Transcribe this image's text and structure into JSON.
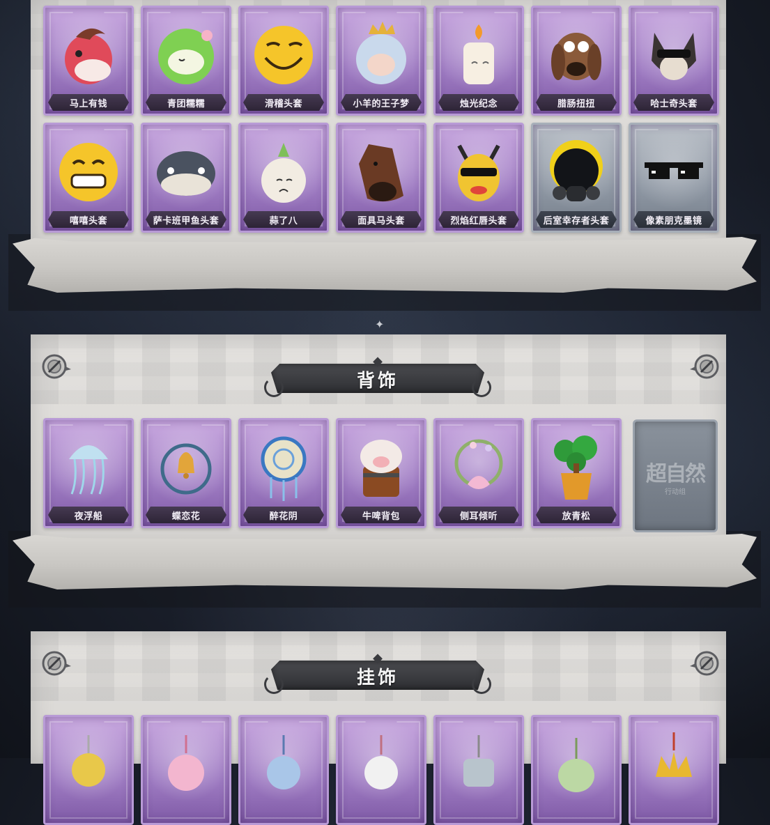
{
  "sections": [
    {
      "id": "head",
      "title": "",
      "items": [
        {
          "label": "马上有钱",
          "icon": "red-horse-mask-icon",
          "tint": "purple"
        },
        {
          "label": "青团糯糯",
          "icon": "green-rice-ball-icon",
          "tint": "purple"
        },
        {
          "label": "滑稽头套",
          "icon": "funny-face-icon",
          "tint": "purple"
        },
        {
          "label": "小羊的王子梦",
          "icon": "crowned-sheep-icon",
          "tint": "purple"
        },
        {
          "label": "烛光纪念",
          "icon": "candle-head-icon",
          "tint": "purple"
        },
        {
          "label": "腊肠扭扭",
          "icon": "dachshund-head-icon",
          "tint": "purple"
        },
        {
          "label": "哈士奇头套",
          "icon": "husky-sunglasses-icon",
          "tint": "purple"
        }
      ],
      "items_row2": [
        {
          "label": "嘻嘻头套",
          "icon": "grinning-face-icon",
          "tint": "purple"
        },
        {
          "label": "萨卡班甲鱼头套",
          "icon": "fish-head-icon",
          "tint": "purple"
        },
        {
          "label": "蒜了八",
          "icon": "garlic-head-icon",
          "tint": "purple"
        },
        {
          "label": "面具马头套",
          "icon": "horse-mask-icon",
          "tint": "purple"
        },
        {
          "label": "烈焰红唇头套",
          "icon": "yellow-mask-sunglasses-icon",
          "tint": "purple"
        },
        {
          "label": "后室幸存者头套",
          "icon": "gas-mask-helmet-icon",
          "tint": "gray"
        },
        {
          "label": "像素朋克墨镜",
          "icon": "pixel-sunglasses-icon",
          "tint": "gray"
        }
      ]
    },
    {
      "id": "back",
      "title": "背饰",
      "items": [
        {
          "label": "夜浮船",
          "icon": "jellyfish-ornament-icon",
          "tint": "purple"
        },
        {
          "label": "蝶恋花",
          "icon": "bell-wreath-icon",
          "tint": "purple"
        },
        {
          "label": "醉花阴",
          "icon": "dreamcatcher-icon",
          "tint": "purple"
        },
        {
          "label": "牛啤背包",
          "icon": "cow-beer-mug-icon",
          "tint": "purple"
        },
        {
          "label": "侧耳倾听",
          "icon": "lotus-wreath-icon",
          "tint": "purple"
        },
        {
          "label": "放青松",
          "icon": "potted-pine-icon",
          "tint": "purple"
        }
      ],
      "placeholder": {
        "watermark": "超自然",
        "watermark_sub": "行动组"
      }
    },
    {
      "id": "pendant",
      "title": "挂饰",
      "items": [
        {
          "label": "",
          "icon": "yellow-pendant-icon",
          "tint": "purple"
        },
        {
          "label": "",
          "icon": "pink-cat-pendant-icon",
          "tint": "purple"
        },
        {
          "label": "",
          "icon": "blue-gem-pendant-icon",
          "tint": "purple"
        },
        {
          "label": "",
          "icon": "white-charm-pendant-icon",
          "tint": "purple"
        },
        {
          "label": "",
          "icon": "robot-pendant-icon",
          "tint": "purple"
        },
        {
          "label": "",
          "icon": "green-pouch-pendant-icon",
          "tint": "purple"
        },
        {
          "label": "",
          "icon": "gold-crown-pendant-icon",
          "tint": "purple"
        }
      ]
    }
  ],
  "colors": {
    "card_purple": "#9e7bc2",
    "card_gray": "#8f98a4",
    "label_bg": "#2d2436",
    "panel": "#dcdad7",
    "background": "#1a1f2b"
  }
}
